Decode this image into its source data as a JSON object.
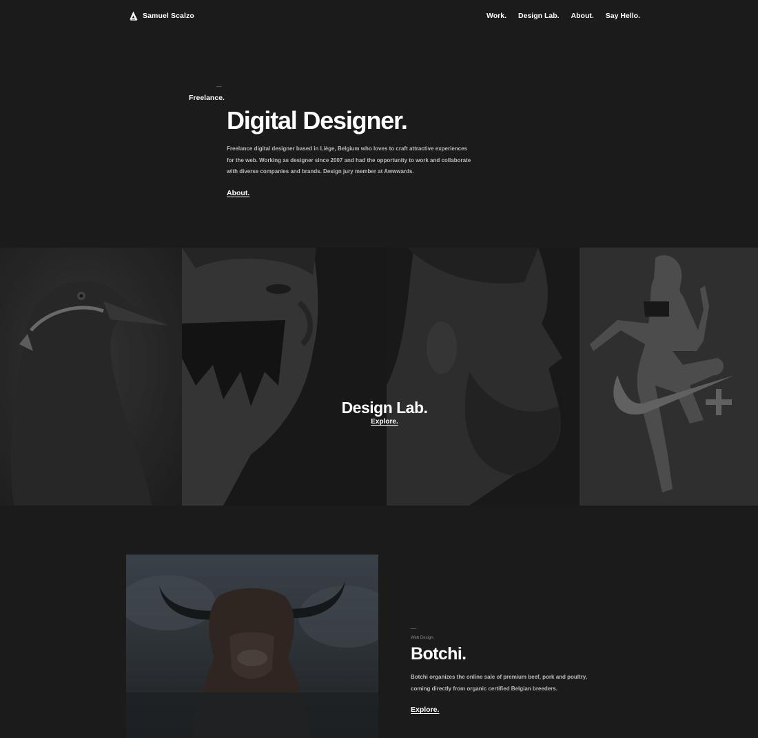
{
  "header": {
    "logo_icon": "stylized-a-logo-icon",
    "logo_text": "Samuel Scalzo",
    "nav": [
      {
        "label": "Work."
      },
      {
        "label": "Design Lab."
      },
      {
        "label": "About."
      },
      {
        "label": "Say Hello."
      }
    ]
  },
  "hero": {
    "eyebrow": "Freelance.",
    "title": "Digital Designer.",
    "description": "Freelance digital designer based in Liège, Belgium who loves to craft attractive experiences for the web. Working as designer since 2007 and had the opportunity to work and collaborate with diverse companies and brands. Design jury member at Awwwards.",
    "link_label": "About."
  },
  "design_lab": {
    "title": "Design Lab.",
    "link_label": "Explore.",
    "panels": [
      {
        "name": "bird-portrait-image"
      },
      {
        "name": "painted-face-portrait-image"
      },
      {
        "name": "bearded-man-profile-image"
      },
      {
        "name": "athlete-swoosh-image"
      }
    ]
  },
  "project": {
    "image": "highland-cow-image",
    "category": "Web Design.",
    "title": "Botchi.",
    "description": "Botchi organizes the online sale of premium beef, pork and poultry, coming directly from organic certified Belgian breeders.",
    "link_label": "Explore."
  },
  "colors": {
    "background": "#1b1b1c",
    "text": "#ffffff",
    "muted_text": "#bcbcbc",
    "accent": "#c1272d"
  }
}
